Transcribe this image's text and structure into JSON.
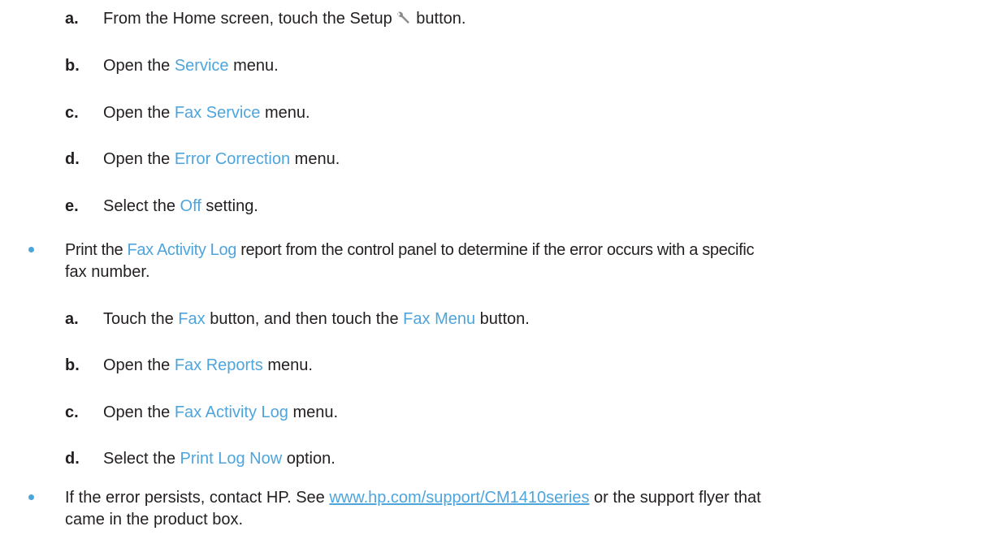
{
  "list1": {
    "steps": [
      {
        "letter": "a.",
        "segments": [
          {
            "text": "From the Home screen, touch the Setup"
          },
          {
            "text": " button."
          }
        ],
        "icon": "wrench-icon"
      },
      {
        "letter": "b.",
        "segments": [
          {
            "text": "Open the "
          },
          {
            "text": "Service"
          },
          {
            "text": " menu."
          }
        ]
      },
      {
        "letter": "c.",
        "segments": [
          {
            "text": "Open the "
          },
          {
            "text": "Fax Service"
          },
          {
            "text": " menu."
          }
        ]
      },
      {
        "letter": "d.",
        "segments": [
          {
            "text": "Open the "
          },
          {
            "text": "Error Correction"
          },
          {
            "text": " menu."
          }
        ]
      },
      {
        "letter": "e.",
        "segments": [
          {
            "text": "Select the "
          },
          {
            "text": "Off"
          },
          {
            "text": " setting."
          }
        ]
      }
    ]
  },
  "bullet1": {
    "line1": [
      {
        "text": "Print the "
      },
      {
        "text": "Fax Activity Log"
      },
      {
        "text": " report from the control panel to determine if the error occurs with a specific"
      }
    ],
    "line2": "fax number."
  },
  "list2": {
    "steps": [
      {
        "letter": "a.",
        "segments": [
          {
            "text": "Touch the "
          },
          {
            "text": "Fax"
          },
          {
            "text": " button, and then touch the "
          },
          {
            "text": "Fax Menu"
          },
          {
            "text": " button."
          }
        ]
      },
      {
        "letter": "b.",
        "segments": [
          {
            "text": "Open the "
          },
          {
            "text": "Fax Reports"
          },
          {
            "text": " menu."
          }
        ]
      },
      {
        "letter": "c.",
        "segments": [
          {
            "text": "Open the "
          },
          {
            "text": "Fax Activity Log"
          },
          {
            "text": " menu."
          }
        ]
      },
      {
        "letter": "d.",
        "segments": [
          {
            "text": "Select the "
          },
          {
            "text": "Print Log Now"
          },
          {
            "text": " option."
          }
        ]
      }
    ]
  },
  "bullet2": {
    "line1": [
      {
        "text": "If the error persists, contact HP. See "
      },
      {
        "text": "www.hp.com/support/CM1410series"
      },
      {
        "text": " or the support flyer that"
      }
    ],
    "line2": "came in the product box."
  },
  "colors": {
    "text": "#231f20",
    "highlight": "#4ea5dc"
  }
}
